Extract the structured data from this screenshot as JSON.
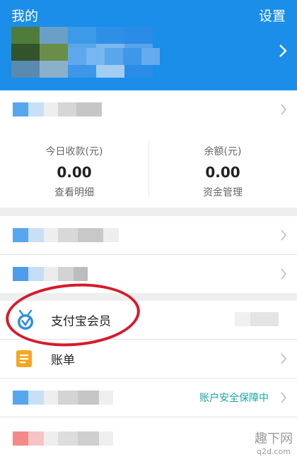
{
  "header": {
    "title": "我的",
    "settings_label": "设置"
  },
  "stats": {
    "left": {
      "label": "今日收款(元)",
      "value": "0.00",
      "link": "查看明细"
    },
    "right": {
      "label": "余额(元)",
      "value": "0.00",
      "link": "资金管理"
    }
  },
  "menu": {
    "member_label": "支付宝会员",
    "bill_label": "账单",
    "security_status": "账户安全保障中"
  },
  "icons": {
    "member": "alipay-member-icon",
    "bill": "bill-document-icon",
    "chevron": "chevron-right-icon"
  },
  "colors": {
    "brand_blue": "#1a8ee8",
    "security_teal": "#1aa5a0",
    "bill_orange": "#f5a623",
    "annotation_red": "#d61a2a"
  },
  "watermark": {
    "line1": "趣下网",
    "line2": "q2d.com"
  }
}
